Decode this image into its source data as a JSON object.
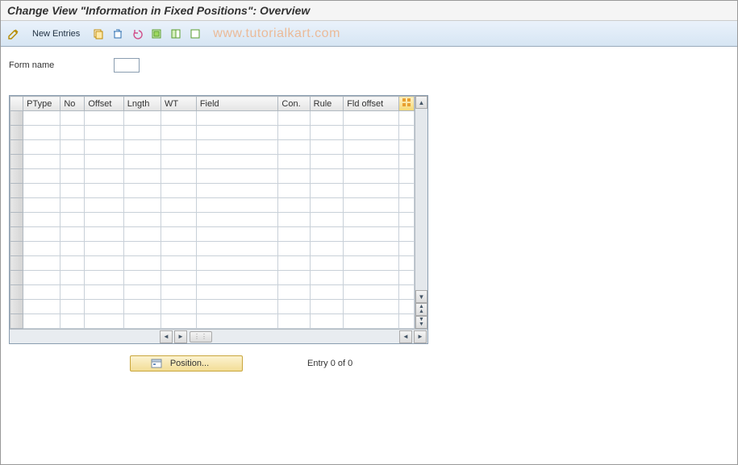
{
  "title": "Change View \"Information in Fixed Positions\": Overview",
  "toolbar": {
    "new_entries_label": "New Entries"
  },
  "watermark": "www.tutorialkart.com",
  "form": {
    "name_label": "Form name",
    "name_value": ""
  },
  "table": {
    "columns": [
      "PType",
      "No",
      "Offset",
      "Lngth",
      "WT",
      "Field",
      "Con.",
      "Rule",
      "Fld offset"
    ],
    "row_count": 15
  },
  "footer": {
    "position_label": "Position...",
    "entry_text": "Entry 0 of 0"
  }
}
